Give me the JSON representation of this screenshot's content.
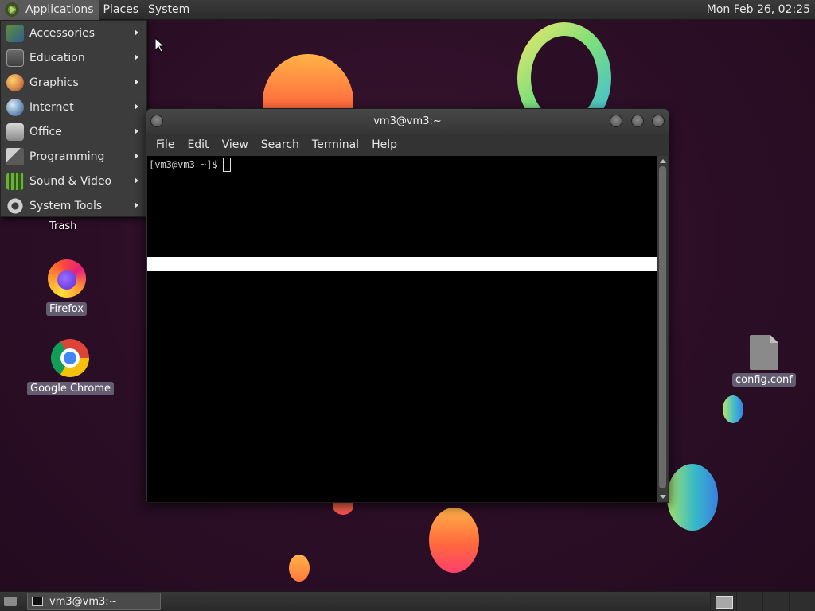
{
  "top_panel": {
    "menus": [
      {
        "label": "Applications",
        "icon": "mate-logo-icon"
      },
      {
        "label": "Places"
      },
      {
        "label": "System"
      }
    ],
    "clock": "Mon Feb 26, 02:25"
  },
  "app_menu": {
    "items": [
      {
        "label": "Accessories",
        "icon": "accessories-icon"
      },
      {
        "label": "Education",
        "icon": "education-icon"
      },
      {
        "label": "Graphics",
        "icon": "graphics-icon"
      },
      {
        "label": "Internet",
        "icon": "internet-icon"
      },
      {
        "label": "Office",
        "icon": "office-icon"
      },
      {
        "label": "Programming",
        "icon": "programming-icon"
      },
      {
        "label": "Sound & Video",
        "icon": "sound-video-icon"
      },
      {
        "label": "System Tools",
        "icon": "system-tools-icon"
      }
    ]
  },
  "desktop": {
    "icons": [
      {
        "label": "Trash",
        "icon": "trash-icon"
      },
      {
        "label": "Firefox",
        "icon": "firefox-icon"
      },
      {
        "label": "Google Chrome",
        "icon": "chrome-icon"
      },
      {
        "label": "config.conf",
        "icon": "file-icon"
      }
    ]
  },
  "terminal": {
    "title": "vm3@vm3:~",
    "menus": [
      "File",
      "Edit",
      "View",
      "Search",
      "Terminal",
      "Help"
    ],
    "prompt": "[vm3@vm3 ~]$"
  },
  "bottom_panel": {
    "task": {
      "label": "vm3@vm3:~",
      "icon": "terminal-icon"
    }
  },
  "colors": {
    "panel": "#2c2c2c",
    "menu_bg": "#3c3c3c",
    "desktop_bg": "#2b0e26",
    "terminal_bg": "#000000"
  }
}
